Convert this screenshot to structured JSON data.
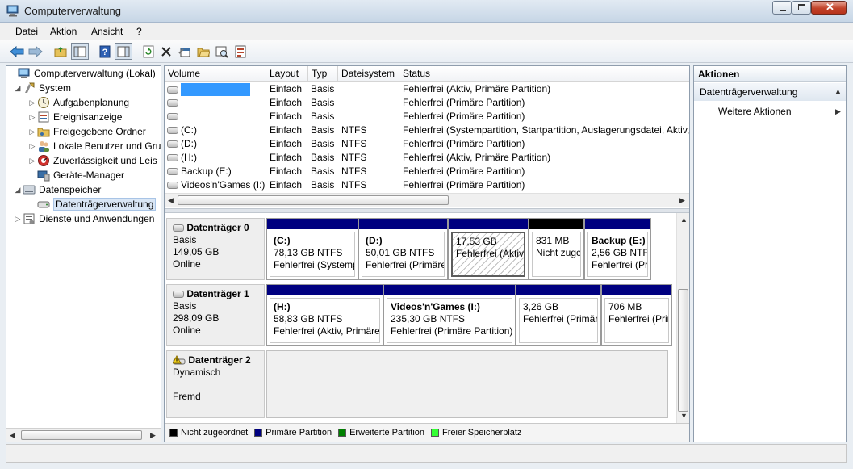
{
  "window": {
    "title": "Computerverwaltung"
  },
  "menu": [
    "Datei",
    "Aktion",
    "Ansicht",
    "?"
  ],
  "tree": {
    "root": "Computerverwaltung (Lokal)",
    "system": "System",
    "aufgaben": "Aufgabenplanung",
    "ereignis": "Ereignisanzeige",
    "freigabe": "Freigegebene Ordner",
    "benutzer": "Lokale Benutzer und Gru",
    "zuverl": "Zuverlässigkeit und Leis",
    "geraete": "Geräte-Manager",
    "speicher": "Datenspeicher",
    "datentraeger": "Datenträgerverwaltung",
    "dienste": "Dienste und Anwendungen"
  },
  "volume_table": {
    "headers": [
      "Volume",
      "Layout",
      "Typ",
      "Dateisystem",
      "Status"
    ],
    "rows": [
      {
        "volume": "",
        "layout": "Einfach",
        "typ": "Basis",
        "fs": "",
        "status": "Fehlerfrei (Aktiv, Primäre Partition)"
      },
      {
        "volume": "",
        "layout": "Einfach",
        "typ": "Basis",
        "fs": "",
        "status": "Fehlerfrei (Primäre Partition)"
      },
      {
        "volume": "",
        "layout": "Einfach",
        "typ": "Basis",
        "fs": "",
        "status": "Fehlerfrei (Primäre Partition)"
      },
      {
        "volume": "(C:)",
        "layout": "Einfach",
        "typ": "Basis",
        "fs": "NTFS",
        "status": "Fehlerfrei (Systempartition, Startpartition, Auslagerungsdatei, Aktiv,"
      },
      {
        "volume": "(D:)",
        "layout": "Einfach",
        "typ": "Basis",
        "fs": "NTFS",
        "status": "Fehlerfrei (Primäre Partition)"
      },
      {
        "volume": "(H:)",
        "layout": "Einfach",
        "typ": "Basis",
        "fs": "NTFS",
        "status": "Fehlerfrei (Aktiv, Primäre Partition)"
      },
      {
        "volume": "Backup (E:)",
        "layout": "Einfach",
        "typ": "Basis",
        "fs": "NTFS",
        "status": "Fehlerfrei (Primäre Partition)"
      },
      {
        "volume": "Videos'n'Games (I:)",
        "layout": "Einfach",
        "typ": "Basis",
        "fs": "NTFS",
        "status": "Fehlerfrei (Primäre Partition)"
      }
    ]
  },
  "disks": [
    {
      "name": "Datenträger 0",
      "kind": "Basis",
      "size": "149,05 GB",
      "state": "Online",
      "partitions": [
        {
          "name": "(C:)",
          "size": "78,13 GB NTFS",
          "status": "Fehlerfrei (Systemp"
        },
        {
          "name": "(D:)",
          "size": "50,01 GB NTFS",
          "status": "Fehlerfrei (Primäre"
        },
        {
          "name": "",
          "size": "17,53 GB",
          "status": "Fehlerfrei (Aktiv,"
        },
        {
          "name": "",
          "size": "831 MB",
          "status": "Nicht zugeordnet"
        },
        {
          "name": "Backup  (E:)",
          "size": "2,56 GB NTFS",
          "status": "Fehlerfrei (Pr"
        }
      ]
    },
    {
      "name": "Datenträger 1",
      "kind": "Basis",
      "size": "298,09 GB",
      "state": "Online",
      "partitions": [
        {
          "name": "(H:)",
          "size": "58,83 GB NTFS",
          "status": "Fehlerfrei (Aktiv, Primäre"
        },
        {
          "name": "Videos'n'Games  (I:)",
          "size": "235,30 GB NTFS",
          "status": "Fehlerfrei (Primäre Partition)"
        },
        {
          "name": "",
          "size": "3,26 GB",
          "status": "Fehlerfrei (Primär"
        },
        {
          "name": "",
          "size": "706 MB",
          "status": "Fehlerfrei (Prim"
        }
      ]
    },
    {
      "name": "Datenträger 2",
      "kind": "Dynamisch",
      "size": "",
      "state": "Fremd"
    }
  ],
  "legend": [
    {
      "label": "Nicht zugeordnet",
      "color": "#000000"
    },
    {
      "label": "Primäre Partition",
      "color": "#000080"
    },
    {
      "label": "Erweiterte Partition",
      "color": "#008000"
    },
    {
      "label": "Freier Speicherplatz",
      "color": "#33ff33"
    }
  ],
  "actions": {
    "header": "Aktionen",
    "section": "Datenträgerverwaltung",
    "more": "Weitere Aktionen"
  },
  "colors": {
    "primary_bar": "#000080",
    "unallocated_bar": "#000000",
    "selection": "#3399ff"
  }
}
